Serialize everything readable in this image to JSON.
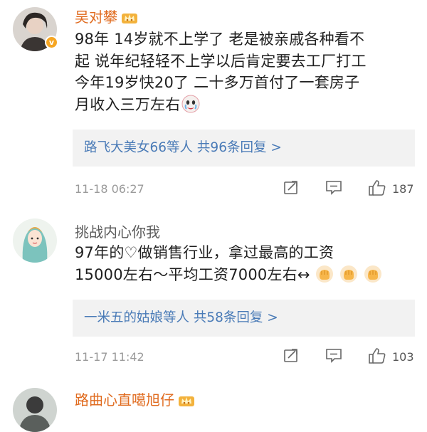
{
  "comments": [
    {
      "username": "吴对攀",
      "verified_badge": "v",
      "text_lines": [
        "98年 14岁就不上学了 老是被亲戚各种看不",
        "起 说年纪轻轻不上学以后肯定要去工厂打工",
        "今年19岁快20了  二十多万首付了一套房子",
        "月收入三万左右"
      ],
      "reply_summary": "路飞大美女66等人  共96条回复 >",
      "timestamp": "11-18 06:27",
      "like_count": "187"
    },
    {
      "username": "挑战内心你我",
      "text_lines": [
        "97年的♡做销售行业，拿过最高的工资",
        "15000左右～平均工资7000左右↔"
      ],
      "reply_summary": "一米五的姑娘等人  共58条回复 >",
      "timestamp": "11-17 11:42",
      "like_count": "103"
    },
    {
      "username": "路曲心直噶旭仔"
    }
  ],
  "colors": {
    "username_accent": "#e06b1f",
    "reply_link": "#4a7bb7",
    "reply_bg": "#f2f2f2",
    "meta_gray": "#9a9a9a"
  },
  "icons": [
    "crown-emoji-icon",
    "verified-badge-icon",
    "forward-icon",
    "comment-icon",
    "like-icon",
    "fist-emoji-icon",
    "crying-emoji-icon"
  ]
}
